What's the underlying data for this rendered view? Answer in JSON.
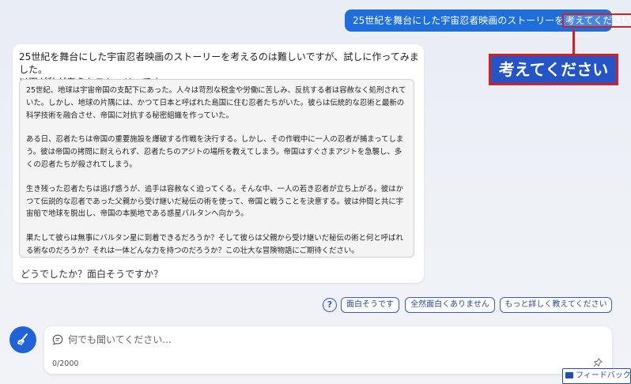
{
  "conversation": {
    "user_message": {
      "prefix": "25世紀を舞台にした宇宙忍者映画のストーリーを",
      "highlight": "考えてください"
    },
    "callout_label": "考えてください",
    "bot_response": {
      "intro_line1": "25世紀を舞台にした宇宙忍者映画のストーリーを考えるのは難しいですが、試しに作ってみました。",
      "intro_line2": "以下が私が考えたストーリーです。",
      "story_paragraphs": [
        "25世紀、地球は宇宙帝国の支配下にあった。人々は苛烈な税金や労働に苦しみ、反抗する者は容赦なく処刑されていた。しかし、地球の片隅には、かつて日本と呼ばれた島国に住む忍者たちがいた。彼らは伝統的な忍術と最新の科学技術を融合させ、帝国に対抗する秘密組織を作っていた。",
        "ある日、忍者たちは帝国の重要施設を爆破する作戦を決行する。しかし、その作戦中に一人の忍者が捕まってしまう。彼は帝国の拷問に耐えられず、忍者たちのアジトの場所を教えてしまう。帝国はすぐさまアジトを急襲し、多くの忍者たちが殺されてしまう。",
        "生き残った忍者たちは逃げ惑うが、追手は容赦なく迫ってくる。そんな中、一人の若き忍者が立ち上がる。彼はかつて伝説的な忍者であった父親から受け継いだ秘伝の術を使って、帝国と戦うことを決意する。彼は仲間と共に宇宙船で地球を脱出し、帝国の本拠地である惑星バルタンへ向かう。",
        "果たして彼らは無事にバルタン星に到着できるだろうか？そして彼らは父親から受け継いだ秘伝の術と何と呼ばれる術なのだろうか？それは一体どんな力を持つのだろうか？この壮大な冒険物語にご期待ください。"
      ],
      "footer": "どうでしたか？面白そうですか？"
    }
  },
  "suggestions": {
    "help_icon": "?",
    "chips": [
      "面白そうです",
      "全然面白くありません",
      "もっと詳しく教えてください"
    ]
  },
  "composer": {
    "new_topic_icon": "broom-icon",
    "placeholder": "何でも聞いてください...",
    "char_count": "0/2000"
  },
  "feedback": {
    "label": "フィードバック"
  },
  "colors": {
    "user_bubble": "#1e6fdc",
    "highlight_border": "#d81f1f",
    "callout_bg": "#2354c8",
    "chip_border": "#3a5bbf"
  }
}
